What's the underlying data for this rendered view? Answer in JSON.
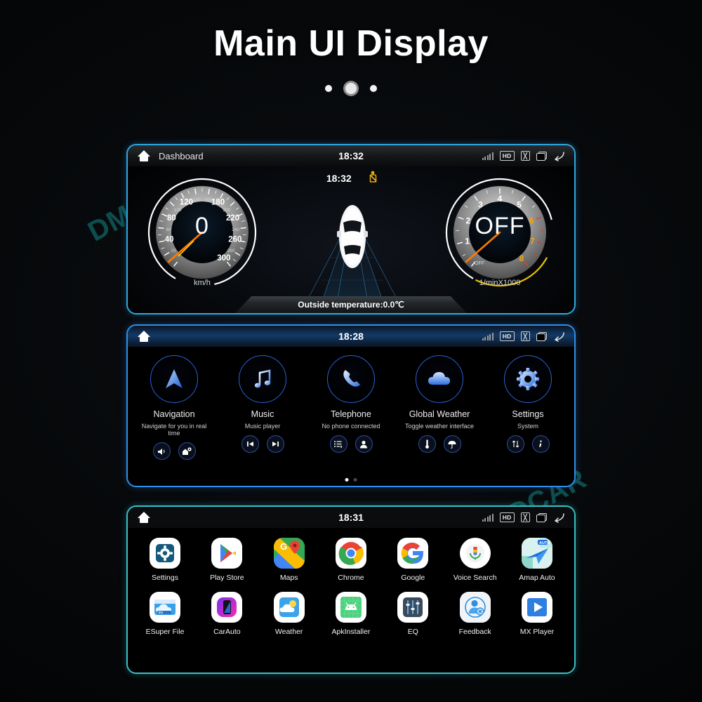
{
  "header": {
    "title": "Main UI Display",
    "dots": [
      "inactive",
      "active",
      "inactive"
    ]
  },
  "watermarks": {
    "text1": "DMDCAR",
    "text2": "DMDCAR"
  },
  "status_icons": {
    "signal": "signal-bars-icon",
    "hd": "HD",
    "mute": "x-box-icon",
    "recent": "recent-apps-icon",
    "back": "back-arrow-icon"
  },
  "panel_dashboard": {
    "statusbar": {
      "home": "home-icon",
      "title": "Dashboard",
      "clock": "18:32"
    },
    "center": {
      "clock": "18:32",
      "warning_icon": "seatbelt-warning-icon"
    },
    "speedometer": {
      "value": "0",
      "unit": "km/h",
      "major_ticks": [
        0,
        20,
        40,
        60,
        80,
        100,
        120,
        140,
        160,
        180,
        200,
        220,
        240,
        260,
        280,
        300
      ],
      "labeled_large": [
        40,
        80,
        120,
        180,
        220,
        260,
        300
      ],
      "min": 0,
      "max": 300
    },
    "tachometer": {
      "value": "OFF",
      "unit": "1/minX1000",
      "off_label": "OFF",
      "major_ticks": [
        1,
        2,
        3,
        4,
        5,
        6,
        7,
        8
      ],
      "redline_start": 6,
      "min": 0,
      "max": 8
    },
    "temperature": "Outside temperature:0.0℃"
  },
  "panel_apps": {
    "statusbar": {
      "home": "home-icon",
      "clock": "18:28"
    },
    "items": [
      {
        "icon": "navigation-arrow-icon",
        "label": "Navigation",
        "sub": "Navigate for you in real time",
        "actions": [
          "nav-voice-icon",
          "nav-home-pin-icon"
        ]
      },
      {
        "icon": "music-note-icon",
        "label": "Music",
        "sub": "Music player",
        "actions": [
          "previous-track-icon",
          "next-track-icon"
        ]
      },
      {
        "icon": "phone-handset-icon",
        "label": "Telephone",
        "sub": "No phone connected",
        "actions": [
          "call-log-icon",
          "contacts-icon"
        ]
      },
      {
        "icon": "cloud-icon",
        "label": "Global Weather",
        "sub": "Toggle weather interface",
        "actions": [
          "thermometer-icon",
          "umbrella-icon"
        ]
      },
      {
        "icon": "gear-icon",
        "label": "Settings",
        "sub": "System",
        "actions": [
          "sync-arrows-icon",
          "info-icon"
        ]
      }
    ],
    "page_dots": [
      "active",
      "inactive"
    ]
  },
  "panel_grid": {
    "statusbar": {
      "home": "home-icon",
      "clock": "18:31"
    },
    "row1": [
      {
        "icon": "settings-gear-app-icon",
        "label": "Settings"
      },
      {
        "icon": "play-store-app-icon",
        "label": "Play Store"
      },
      {
        "icon": "google-maps-app-icon",
        "label": "Maps"
      },
      {
        "icon": "chrome-app-icon",
        "label": "Chrome"
      },
      {
        "icon": "google-app-icon",
        "label": "Google"
      },
      {
        "icon": "voice-search-app-icon",
        "label": "Voice Search"
      },
      {
        "icon": "amap-auto-app-icon",
        "label": "Amap Auto"
      }
    ],
    "row2": [
      {
        "icon": "esuper-file-app-icon",
        "label": "ESuper File"
      },
      {
        "icon": "carauto-app-icon",
        "label": "CarAuto"
      },
      {
        "icon": "weather-app-icon",
        "label": "Weather"
      },
      {
        "icon": "apkinstaller-app-icon",
        "label": "ApkInstaller"
      },
      {
        "icon": "eq-app-icon",
        "label": "EQ"
      },
      {
        "icon": "feedback-app-icon",
        "label": "Feedback"
      },
      {
        "icon": "mx-player-app-icon",
        "label": "MX Player"
      }
    ]
  },
  "colors": {
    "accent_cyan": "#39c0c8",
    "accent_blue": "#2ea8e0",
    "ring_blue": "#2b62d8",
    "watermark": "#127878",
    "warning_yellow": "#e8a90f"
  }
}
